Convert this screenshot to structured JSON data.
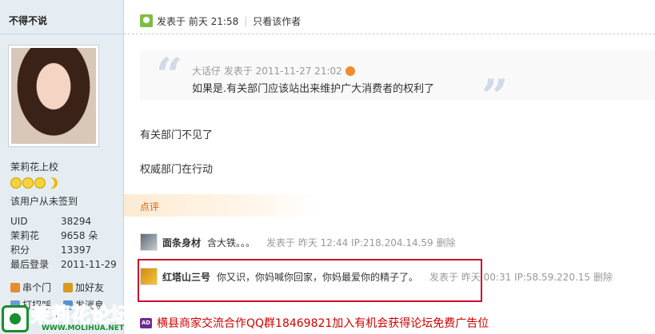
{
  "sidebar": {
    "username": "不得不说",
    "rank": "茉莉花上校",
    "signin_status": "该用户从未签到",
    "stats": [
      {
        "label": "UID",
        "value": "38294"
      },
      {
        "label": "茉莉花",
        "value": "9658 朵"
      },
      {
        "label": "积分",
        "value": "13397"
      },
      {
        "label": "最后登录",
        "value": "2011-11-29"
      }
    ],
    "actions": [
      {
        "label": "串个门",
        "icon": "house-icon",
        "color": "#e88a2e"
      },
      {
        "label": "加好友",
        "icon": "add-friend-icon",
        "color": "#d69a1e"
      },
      {
        "label": "打招呼",
        "icon": "wave-icon",
        "color": "#6d9bd6"
      },
      {
        "label": "发消息",
        "icon": "message-icon",
        "color": "#5a8fcf"
      }
    ]
  },
  "logo": {
    "text": "茉莉花论坛",
    "domain": "WWW.MOLIHUA.NET",
    "color": "#1a8e2c"
  },
  "post": {
    "posted_label": "发表于 前天 21:58",
    "author_only_link": "只看该作者",
    "quote": {
      "meta": "大话仔 发表于 2011-11-27 21:02",
      "text": "如果是.有关部门应该站出来维护广大消费者的权利了"
    },
    "body_lines": [
      "有关部门不见了",
      "权威部门在行动"
    ]
  },
  "comments": {
    "section_label": "点评",
    "items": [
      {
        "name": "面条身材",
        "text": "含大铁。。。",
        "meta": "发表于 昨天 12:44 IP:218.204.14.59",
        "delete_label": "删除"
      },
      {
        "name": "红塔山三号",
        "text": "你又识，你妈喊你回家，你妈最爱你的精子了。",
        "meta": "发表于 昨天 00:31 IP:58.59.220.15",
        "delete_label": "删除"
      }
    ]
  },
  "ad": {
    "badge": "AD",
    "text": "横县商家交流合作QQ群18469821加入有机会获得论坛免费广告位"
  },
  "colors": {
    "accent_orange": "#e05f00",
    "ad_red": "#d00000",
    "highlight_red": "#c8102e",
    "sidebar_bg": "#e5edf2"
  }
}
